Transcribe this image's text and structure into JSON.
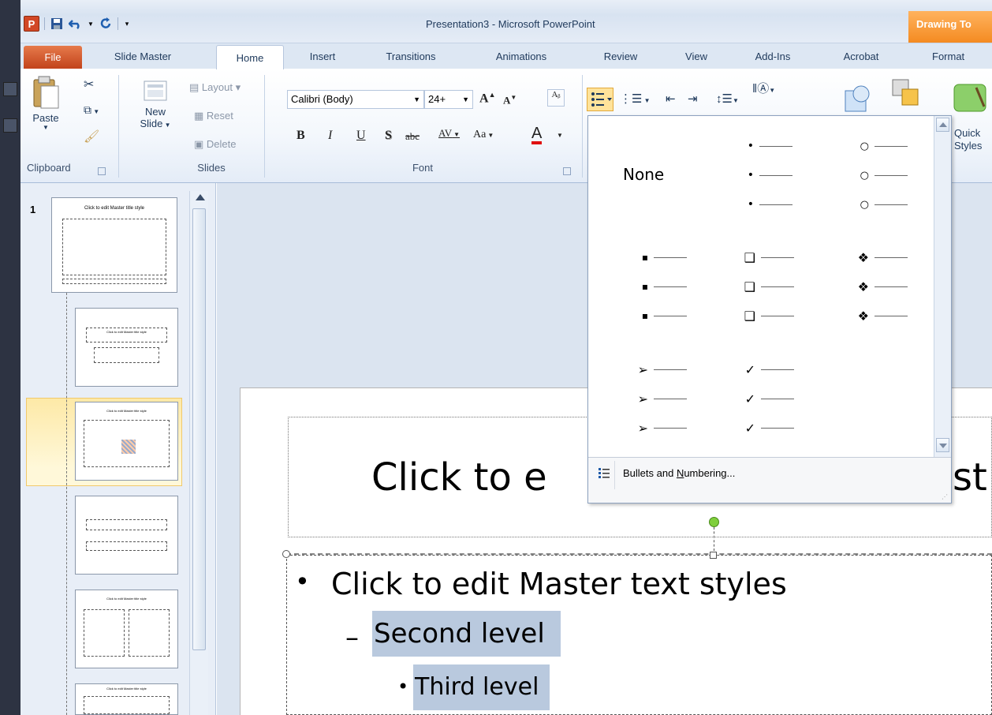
{
  "window": {
    "title": "Presentation3 - Microsoft PowerPoint",
    "contextual_tab": "Drawing To",
    "app_icon": "P"
  },
  "tabs": [
    {
      "label": "File",
      "id": "file"
    },
    {
      "label": "Slide Master",
      "id": "slide-master"
    },
    {
      "label": "Home",
      "id": "home"
    },
    {
      "label": "Insert",
      "id": "insert"
    },
    {
      "label": "Transitions",
      "id": "transitions"
    },
    {
      "label": "Animations",
      "id": "animations"
    },
    {
      "label": "Review",
      "id": "review"
    },
    {
      "label": "View",
      "id": "view"
    },
    {
      "label": "Add-Ins",
      "id": "add-ins"
    },
    {
      "label": "Acrobat",
      "id": "acrobat"
    },
    {
      "label": "Format",
      "id": "format"
    }
  ],
  "ribbon": {
    "clipboard": {
      "label": "Clipboard",
      "paste": "Paste"
    },
    "slides": {
      "label": "Slides",
      "new_slide_1": "New",
      "new_slide_2": "Slide",
      "layout": "Layout",
      "reset": "Reset",
      "delete": "Delete"
    },
    "font": {
      "label": "Font",
      "font_name": "Calibri (Body)",
      "font_size": "24+",
      "bold": "B",
      "italic": "I",
      "underline": "U",
      "shadow": "S",
      "strike": "abc",
      "spacing": "AV",
      "case": "Aa",
      "color": "A"
    },
    "drawing": {
      "quick_styles_1": "Quick",
      "quick_styles_2": "Styles"
    }
  },
  "bullet_dropdown": {
    "none_label": "None",
    "styles": [
      {
        "glyph": "•",
        "name": "small-bullet"
      },
      {
        "glyph": "○",
        "name": "hollow-round"
      },
      {
        "glyph": "▪",
        "name": "square-filled"
      },
      {
        "glyph": "❑",
        "name": "hollow-square"
      },
      {
        "glyph": "❖",
        "name": "star-diamond"
      },
      {
        "glyph": "➢",
        "name": "arrow"
      },
      {
        "glyph": "✓",
        "name": "checkmark"
      }
    ],
    "footer_label": "Bullets and Numbering...",
    "footer_mnemonic": "N"
  },
  "slides_panel": {
    "first_slide_number": "1",
    "master_title": "Click to edit Master title style",
    "thumb_title": "Click to edit Master title style"
  },
  "slide": {
    "title_placeholder": "Click to e",
    "title_tail": "st",
    "body_level1": "Click to edit Master text styles",
    "body_level2": "Second level",
    "body_level3": "Third level",
    "bullet1": "•",
    "bullet2": "–",
    "bullet3": "•"
  }
}
